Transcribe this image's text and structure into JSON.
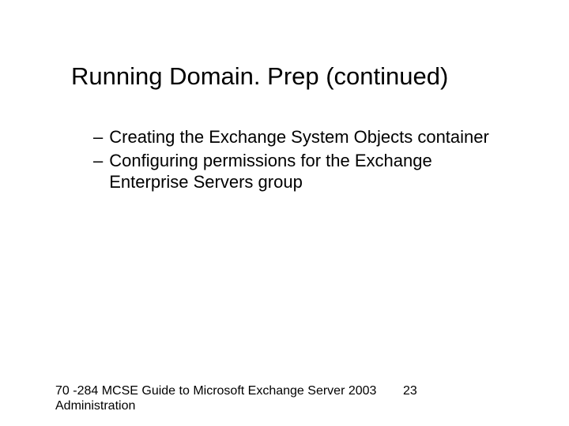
{
  "slide": {
    "title": "Running Domain. Prep (continued)",
    "bullets": [
      {
        "dash": "–",
        "text": "Creating the Exchange System Objects container"
      },
      {
        "dash": "–",
        "text": "Configuring permissions for the Exchange Enterprise Servers group"
      }
    ],
    "footer_text": "70 -284 MCSE Guide to Microsoft Exchange Server 2003 Administration",
    "page_number": "23"
  }
}
